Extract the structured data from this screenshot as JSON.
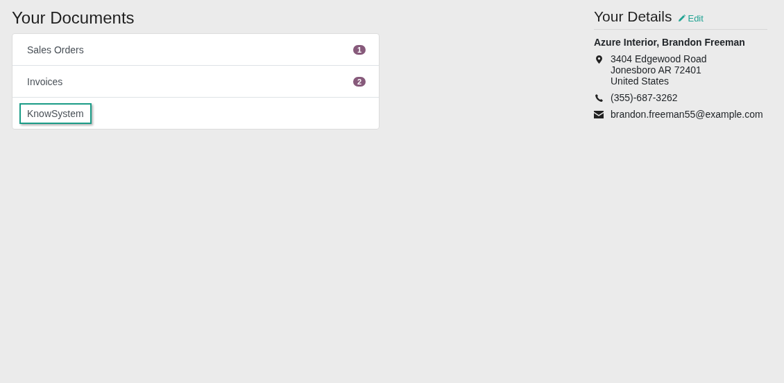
{
  "documents": {
    "title": "Your Documents",
    "items": [
      {
        "label": "Sales Orders",
        "count": "1",
        "focused": false
      },
      {
        "label": "Invoices",
        "count": "2",
        "focused": false
      },
      {
        "label": "KnowSystem",
        "focused": true
      }
    ]
  },
  "details": {
    "title": "Your Details",
    "edit_link": "Edit",
    "name": "Azure Interior, Brandon Freeman",
    "contacts": [
      {
        "kind": "address",
        "lines": [
          "3404 Edgewood Road",
          "Jonesboro AR 72401",
          "United States"
        ]
      },
      {
        "kind": "phone",
        "lines": [
          "(355)-687-3262"
        ]
      },
      {
        "kind": "email",
        "lines": [
          "brandon.freeman55@example.com"
        ]
      }
    ]
  }
}
